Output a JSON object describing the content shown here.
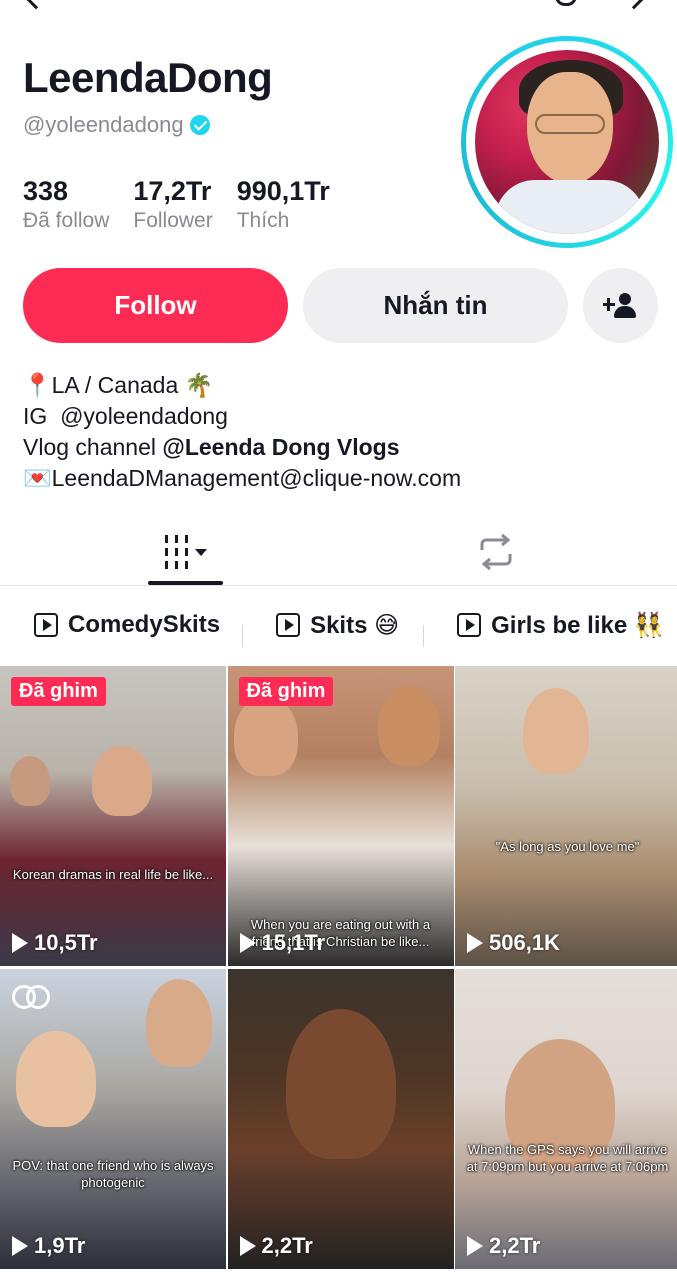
{
  "profile": {
    "display_name": "LeendaDong",
    "username": "@yoleendadong",
    "stats": [
      {
        "value": "338",
        "label": "Đã follow"
      },
      {
        "value": "17,2Tr",
        "label": "Follower"
      },
      {
        "value": "990,1Tr",
        "label": "Thích"
      }
    ]
  },
  "actions": {
    "follow_label": "Follow",
    "message_label": "Nhắn tin"
  },
  "bio": {
    "location": "📍LA / Canada 🌴",
    "ig_prefix": "IG",
    "ig_handle": "@yoleendadong",
    "vlog_prefix": "Vlog channel",
    "vlog_channel": "@Leenda Dong Vlogs",
    "email": "💌LeendaDManagement@clique-now.com"
  },
  "playlists": [
    {
      "label": "ComedySkits"
    },
    {
      "label": "Skits 😅"
    },
    {
      "label": "Girls be like 👯"
    }
  ],
  "videos": [
    {
      "badge": "Đã ghim",
      "caption": "Korean dramas in real life be like...",
      "views": "10,5Tr"
    },
    {
      "badge": "Đã ghim",
      "caption": "When you are eating out with a friend that is Christian be like...",
      "views": "15,1Tr"
    },
    {
      "badge": "",
      "caption": "\"As long as you love me\"",
      "views": "506,1K"
    },
    {
      "badge": "",
      "caption": "POV: that one friend who is always photogenic",
      "views": "1,9Tr"
    },
    {
      "badge": "",
      "caption": "",
      "views": "2,2Tr"
    },
    {
      "badge": "",
      "caption": "When the GPS says you will arrive at 7:09pm but you arrive at 7:06pm",
      "views": "2,2Tr"
    }
  ],
  "colors": {
    "accent": "#fe2c55",
    "verified": "#20d5ec",
    "text_primary": "#161823",
    "text_secondary": "#8a8b91"
  }
}
